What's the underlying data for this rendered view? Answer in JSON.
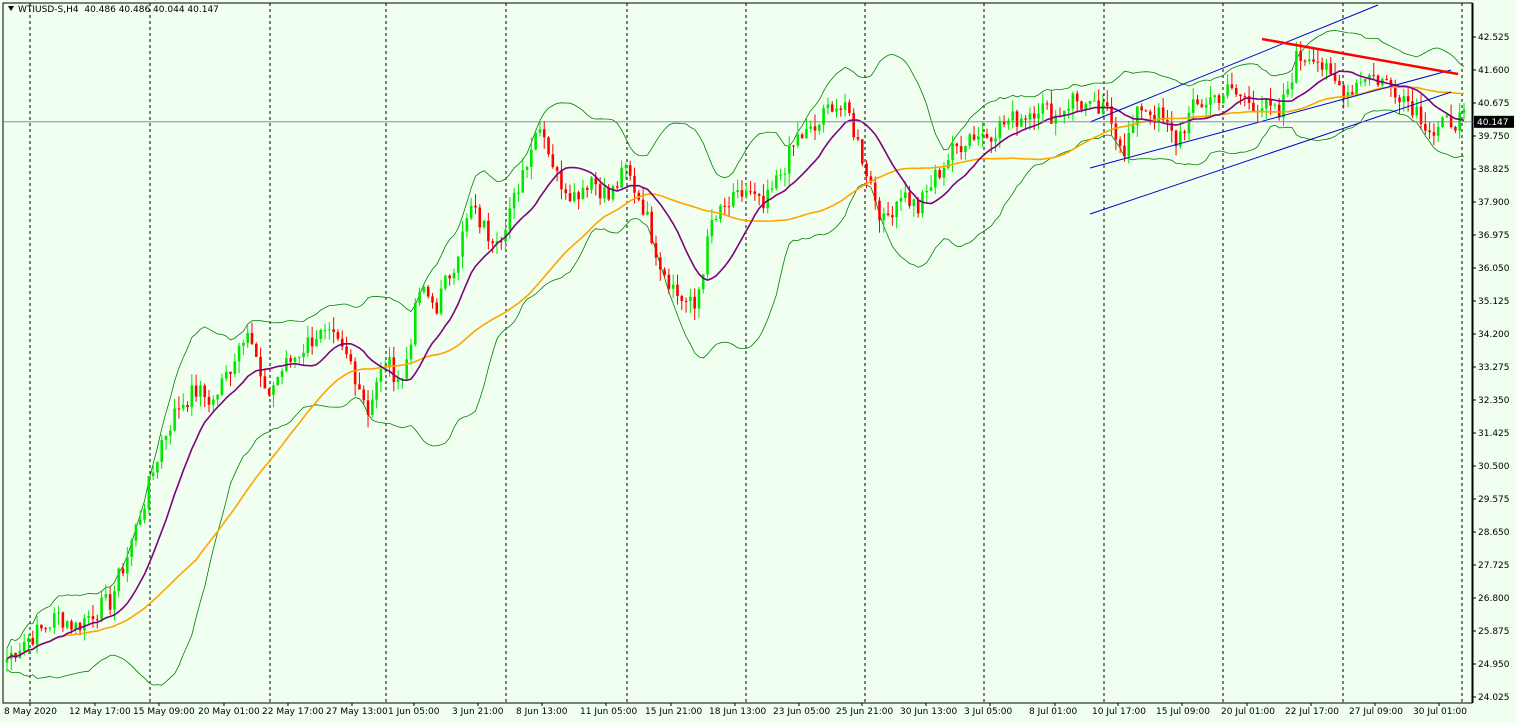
{
  "header": {
    "symbol": "WTIUSD-S,H4",
    "ohlc": "40.486 40.486 40.044 40.147"
  },
  "colors": {
    "background": "#f0fff0",
    "bull_candle": "#00e600",
    "bear_candle": "#ff0000",
    "ma_fast": "#800080",
    "ma_slow": "#ffa500",
    "bollinger": "#008000",
    "channel": "#0000cd",
    "trendline": "#ff0000",
    "grid": "#000000"
  },
  "chart_data": {
    "type": "candlestick",
    "symbol": "WTIUSD-S",
    "timeframe": "H4",
    "current_price": "40.147",
    "ylim": [
      24.025,
      43.3
    ],
    "y_ticks": [
      "42.525",
      "41.600",
      "40.675",
      "39.750",
      "38.825",
      "37.900",
      "36.975",
      "36.050",
      "35.125",
      "34.200",
      "33.275",
      "32.350",
      "31.425",
      "30.500",
      "29.575",
      "28.650",
      "27.725",
      "26.800",
      "25.875",
      "24.950",
      "24.025"
    ],
    "x_ticks": [
      "8 May 2020",
      "12 May 17:00",
      "15 May 09:00",
      "20 May 01:00",
      "22 May 17:00",
      "27 May 13:00",
      "1 Jun 05:00",
      "3 Jun 21:00",
      "8 Jun 13:00",
      "11 Jun 05:00",
      "15 Jun 21:00",
      "18 Jun 13:00",
      "23 Jun 05:00",
      "25 Jun 21:00",
      "30 Jun 13:00",
      "3 Jul 05:00",
      "8 Jul 01:00",
      "10 Jul 17:00",
      "15 Jul 09:00",
      "20 Jul 01:00",
      "22 Jul 17:00",
      "27 Jul 09:00",
      "30 Jul 01:00"
    ],
    "x_tick_positions_note": "vertical dashed separators at each x tick",
    "price_path": [
      [
        0,
        25.1
      ],
      [
        4,
        25.6
      ],
      [
        8,
        25.9
      ],
      [
        12,
        26.3
      ],
      [
        16,
        26.0
      ],
      [
        20,
        26.4
      ],
      [
        24,
        26.7
      ],
      [
        28,
        28.0
      ],
      [
        32,
        29.5
      ],
      [
        36,
        31.2
      ],
      [
        40,
        32.2
      ],
      [
        44,
        32.6
      ],
      [
        48,
        32.3
      ],
      [
        52,
        33.3
      ],
      [
        56,
        34.5
      ],
      [
        60,
        32.4
      ],
      [
        64,
        33.2
      ],
      [
        68,
        33.7
      ],
      [
        72,
        34.2
      ],
      [
        76,
        34.0
      ],
      [
        80,
        33.4
      ],
      [
        84,
        32.1
      ],
      [
        88,
        33.4
      ],
      [
        92,
        32.9
      ],
      [
        96,
        35.4
      ],
      [
        100,
        35.0
      ],
      [
        104,
        36.2
      ],
      [
        108,
        37.7
      ],
      [
        112,
        37.0
      ],
      [
        116,
        37.1
      ],
      [
        120,
        38.8
      ],
      [
        124,
        40.2
      ],
      [
        128,
        38.6
      ],
      [
        132,
        38.1
      ],
      [
        136,
        38.6
      ],
      [
        140,
        38.0
      ],
      [
        144,
        38.8
      ],
      [
        148,
        37.8
      ],
      [
        152,
        36.2
      ],
      [
        156,
        35.3
      ],
      [
        160,
        34.9
      ],
      [
        164,
        37.3
      ],
      [
        168,
        37.8
      ],
      [
        172,
        38.2
      ],
      [
        176,
        37.7
      ],
      [
        180,
        38.7
      ],
      [
        184,
        39.7
      ],
      [
        188,
        39.9
      ],
      [
        192,
        40.7
      ],
      [
        196,
        40.3
      ],
      [
        200,
        38.8
      ],
      [
        204,
        37.3
      ],
      [
        208,
        38.2
      ],
      [
        212,
        37.7
      ],
      [
        216,
        38.6
      ],
      [
        220,
        39.3
      ],
      [
        224,
        39.8
      ],
      [
        228,
        39.8
      ],
      [
        232,
        40.1
      ],
      [
        236,
        40.3
      ],
      [
        240,
        40.6
      ],
      [
        244,
        40.3
      ],
      [
        248,
        40.8
      ],
      [
        252,
        40.5
      ],
      [
        256,
        40.4
      ],
      [
        260,
        39.4
      ],
      [
        264,
        40.6
      ],
      [
        268,
        40.3
      ],
      [
        272,
        39.6
      ],
      [
        276,
        40.5
      ],
      [
        280,
        40.8
      ],
      [
        284,
        41.0
      ],
      [
        288,
        40.8
      ],
      [
        292,
        40.6
      ],
      [
        296,
        40.3
      ],
      [
        300,
        41.9
      ],
      [
        304,
        42.1
      ],
      [
        308,
        41.3
      ],
      [
        312,
        41.0
      ],
      [
        316,
        41.5
      ],
      [
        320,
        41.3
      ],
      [
        324,
        41.0
      ],
      [
        328,
        40.5
      ],
      [
        332,
        39.8
      ],
      [
        336,
        40.2
      ]
    ],
    "indicators": [
      "Moving Average (fast)",
      "Moving Average (slow)",
      "Bollinger Bands",
      "Regression Channel",
      "Trendline"
    ],
    "grid": true
  }
}
